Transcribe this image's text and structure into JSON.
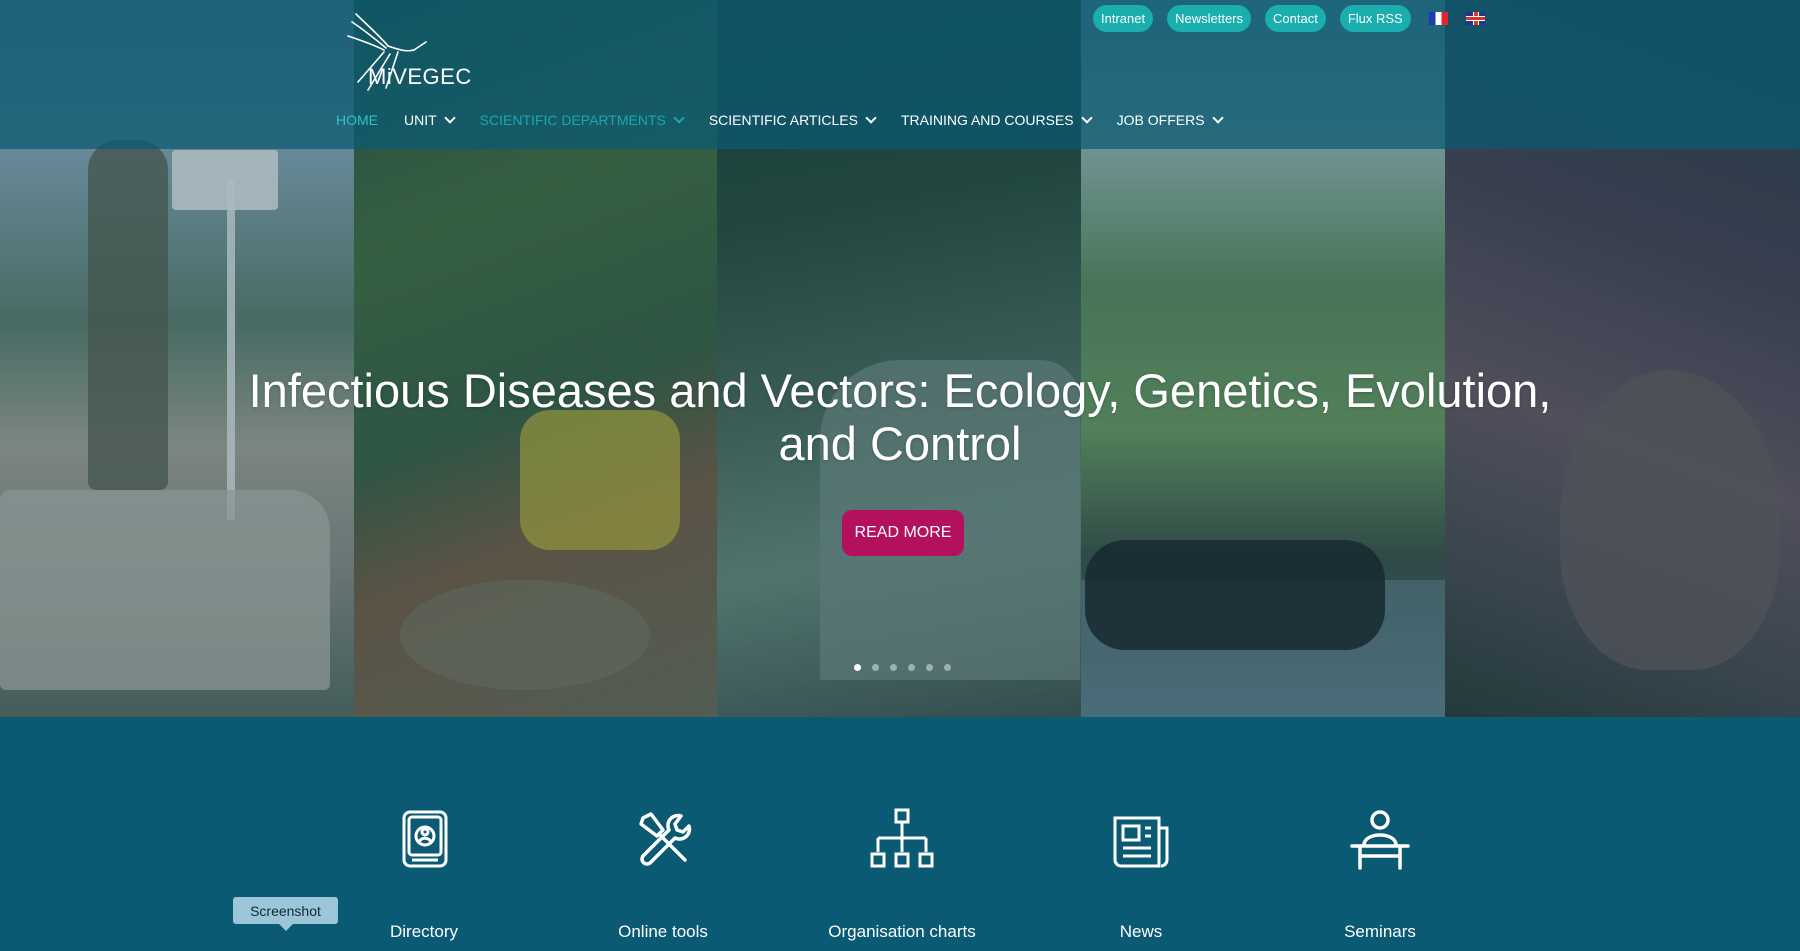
{
  "site": {
    "logo_text": "MiVEGEC"
  },
  "top_links": [
    "Intranet",
    "Newsletters",
    "Contact",
    "Flux RSS"
  ],
  "languages": [
    {
      "code": "fr",
      "icon": "france-flag-icon"
    },
    {
      "code": "en",
      "icon": "uk-flag-icon"
    }
  ],
  "nav": [
    {
      "label": "HOME",
      "dropdown": false,
      "state": "active"
    },
    {
      "label": "UNIT",
      "dropdown": true,
      "state": "normal"
    },
    {
      "label": "SCIENTIFIC DEPARTMENTS",
      "dropdown": true,
      "state": "hover"
    },
    {
      "label": "SCIENTIFIC ARTICLES",
      "dropdown": true,
      "state": "normal"
    },
    {
      "label": "TRAINING AND COURSES",
      "dropdown": true,
      "state": "normal"
    },
    {
      "label": "JOB OFFERS",
      "dropdown": true,
      "state": "normal"
    }
  ],
  "hero": {
    "title_line1": "Infectious Diseases and Vectors: Ecology, Genetics, Evolution,",
    "title_line2": "and Control",
    "button": "READ MORE",
    "slides_count": 6,
    "active_slide": 1
  },
  "shortcuts": [
    {
      "label": "Directory",
      "icon": "directory-icon"
    },
    {
      "label": "Online tools",
      "icon": "tools-icon"
    },
    {
      "label": "Organisation charts",
      "icon": "org-chart-icon"
    },
    {
      "label": "News",
      "icon": "news-icon"
    },
    {
      "label": "Seminars",
      "icon": "seminar-icon"
    }
  ],
  "tooltip": "Screenshot",
  "colors": {
    "brand": "#0a5a73",
    "accent": "#1aaeae",
    "button": "#b3105e",
    "active_nav": "#2fc4c4"
  }
}
